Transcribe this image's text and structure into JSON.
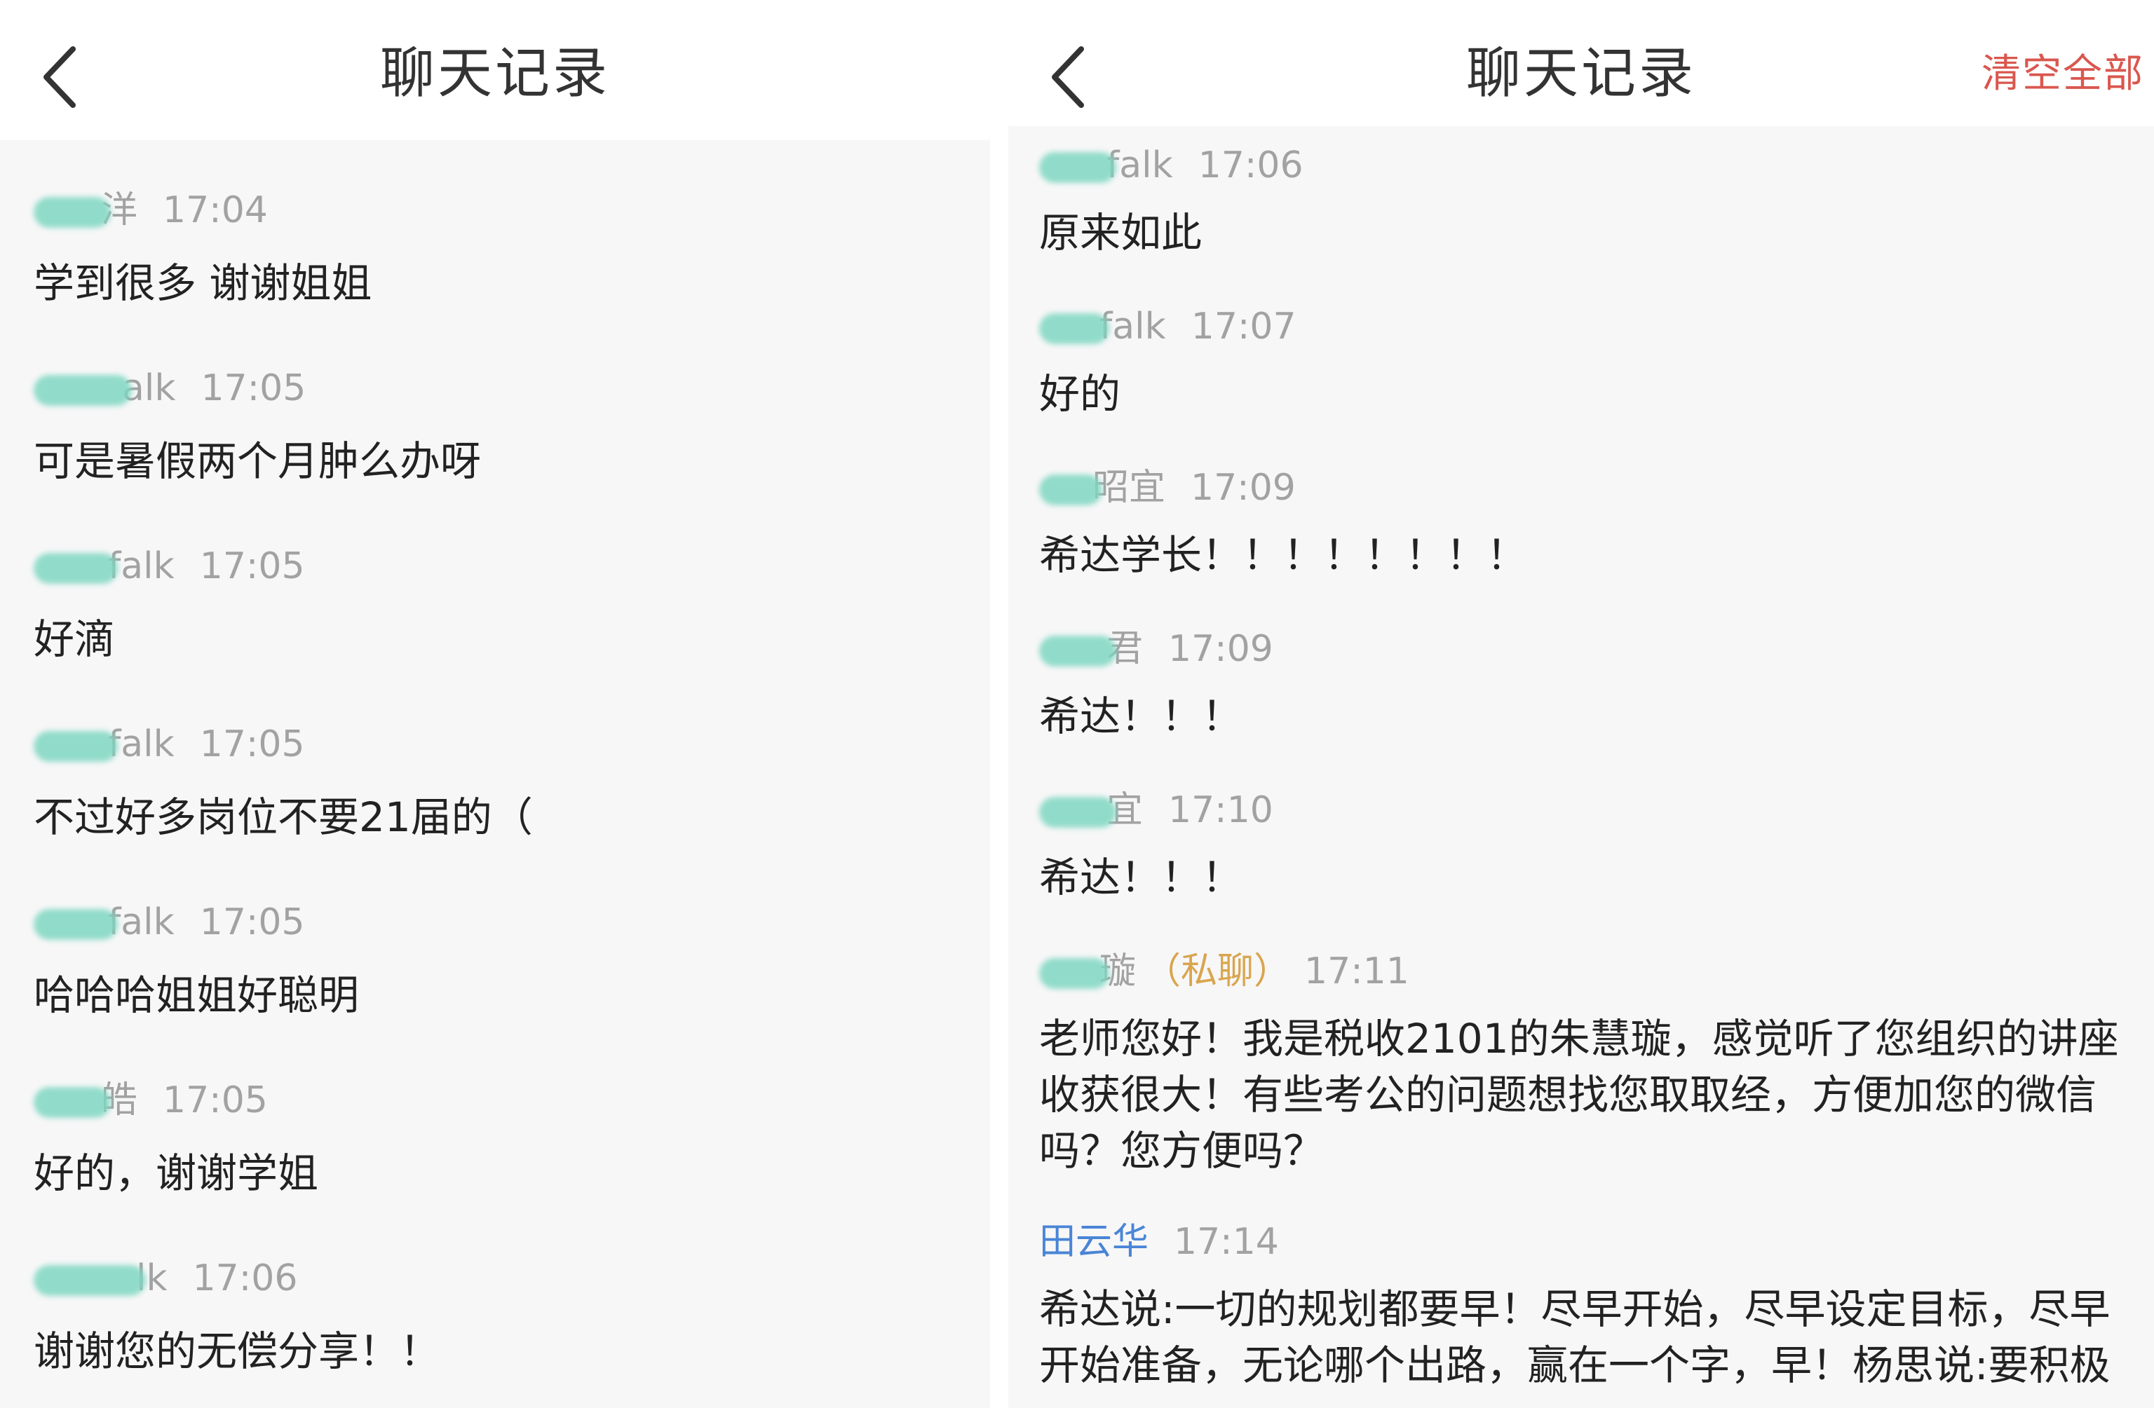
{
  "left": {
    "title": "聊天记录",
    "messages": [
      {
        "sender": "洋",
        "time": "17:04",
        "text": "学到很多 谢谢姐姐"
      },
      {
        "sender": "alk",
        "time": "17:05",
        "text": "可是暑假两个月肿么办呀"
      },
      {
        "sender": "falk",
        "time": "17:05",
        "text": "好滴"
      },
      {
        "sender": "falk",
        "time": "17:05",
        "text": "不过好多岗位不要21届的（"
      },
      {
        "sender": "falk",
        "time": "17:05",
        "text": "哈哈哈姐姐好聪明"
      },
      {
        "sender": "皓",
        "time": "17:05",
        "text": "好的，谢谢学姐"
      },
      {
        "sender": "lk",
        "time": "17:06",
        "text": "谢谢您的无偿分享！！"
      }
    ]
  },
  "right": {
    "title": "聊天记录",
    "clear_label": "清空全部",
    "messages": [
      {
        "sender": "falk",
        "time": "17:06",
        "text": "原来如此"
      },
      {
        "sender": "falk",
        "time": "17:07",
        "text": "好的"
      },
      {
        "sender": "昭宜",
        "time": "17:09",
        "text": "希达学长！！！！！！！！"
      },
      {
        "sender": "君",
        "time": "17:09",
        "text": "希达！！！"
      },
      {
        "sender": "宜",
        "time": "17:10",
        "text": "希达！！！"
      },
      {
        "sender": "璇",
        "tag": "（私聊）",
        "time": "17:11",
        "text": "老师您好！我是税收2101的朱慧璇，感觉听了您组织的讲座收获很大！有些考公的问题想找您取取经，方便加您的微信吗？您方便吗？"
      },
      {
        "sender": "田云华",
        "time": "17:14",
        "text": "希达说:一切的规划都要早！尽早开始，尽早设定目标，尽早开始准备，无论哪个出路，赢在一个字，早！杨思说:要积极"
      }
    ]
  },
  "colors": {
    "accent_red": "#d9574e",
    "private_tag": "#d9a54e",
    "name_blue": "#4a85d6",
    "meta_gray": "#a2a2a2"
  },
  "icons": {
    "back": "chevron-left-icon",
    "redaction": "blur-redaction"
  }
}
